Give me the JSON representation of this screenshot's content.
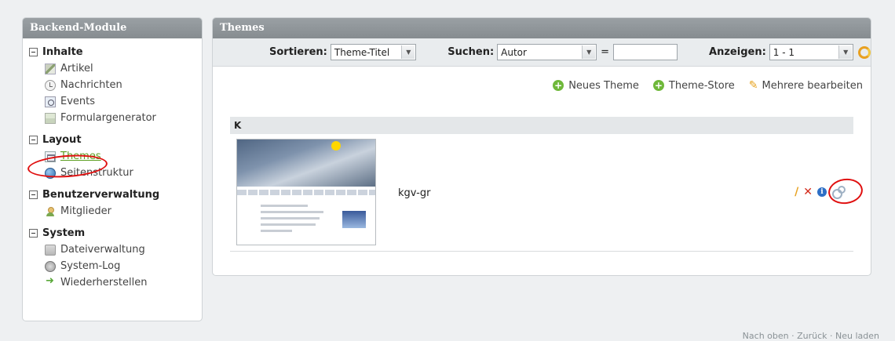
{
  "sidebar": {
    "title": "Backend-Module",
    "groups": [
      {
        "title": "Inhalte",
        "items": [
          {
            "label": "Artikel",
            "icon": "article-icon"
          },
          {
            "label": "Nachrichten",
            "icon": "news-icon"
          },
          {
            "label": "Events",
            "icon": "events-icon"
          },
          {
            "label": "Formulargenerator",
            "icon": "form-icon"
          }
        ]
      },
      {
        "title": "Layout",
        "items": [
          {
            "label": "Themes",
            "icon": "themes-icon",
            "active": true
          },
          {
            "label": "Seitenstruktur",
            "icon": "globe-icon"
          }
        ]
      },
      {
        "title": "Benutzerverwaltung",
        "items": [
          {
            "label": "Mitglieder",
            "icon": "members-icon"
          }
        ]
      },
      {
        "title": "System",
        "items": [
          {
            "label": "Dateiverwaltung",
            "icon": "files-icon"
          },
          {
            "label": "System-Log",
            "icon": "log-icon"
          },
          {
            "label": "Wiederherstellen",
            "icon": "restore-icon"
          }
        ]
      }
    ]
  },
  "main": {
    "title": "Themes",
    "toolbar": {
      "sort_label": "Sortieren:",
      "sort_value": "Theme-Titel",
      "search_label": "Suchen:",
      "search_field": "Autor",
      "equals": "=",
      "search_value": "",
      "show_label": "Anzeigen:",
      "show_value": "1 - 1"
    },
    "actions": {
      "new_theme": "Neues Theme",
      "theme_store": "Theme-Store",
      "edit_multiple": "Mehrere bearbeiten"
    },
    "group_letter": "K",
    "theme": {
      "name": "kgv-gr"
    }
  },
  "footer": {
    "text": "Nach oben · Zurück · Neu laden"
  },
  "colors": {
    "header_bg": "#8f9599",
    "active_nav": "#5c9e20",
    "annotation_red": "#e01010",
    "add_green": "#6fb83a"
  }
}
